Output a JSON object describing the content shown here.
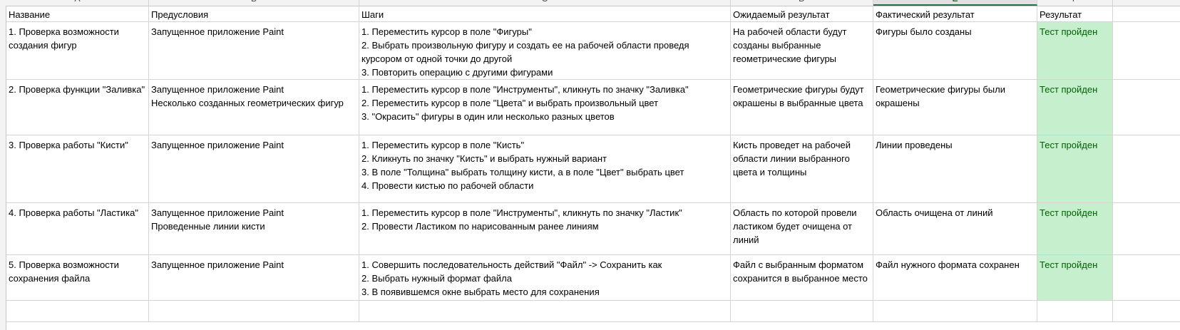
{
  "column_letters": [
    "A",
    "B",
    "C",
    "D",
    "E",
    "F"
  ],
  "selected_column": "E",
  "header": {
    "name": "Название",
    "preconditions": "Предусловия",
    "steps": "Шаги",
    "expected": "Ожидаемый результат",
    "actual": "Фактический результат",
    "result": "Результат"
  },
  "rows": [
    {
      "name": "1. Проверка возможности создания фигур",
      "preconditions": "Запущенное приложение Paint",
      "steps": "1. Переместить курсор в поле \"Фигуры\"\n2. Выбрать произвольную фигуру и создать ее на рабочей области проведя курсором от одной точки до другой\n3. Повторить операцию с другими фигурами",
      "expected": "На рабочей области будут созданы выбранные геометрические фигуры",
      "actual": "Фигуры было созданы",
      "result": "Тест пройден"
    },
    {
      "name": "2. Проверка функции \"Заливка\"",
      "preconditions": "Запущенное приложение Paint\nНесколько созданных геометрических фигур",
      "steps": "1. Переместить курсор в поле \"Инструменты\", кликнуть по значку \"Заливка\"\n2. Переместить курсор в поле \"Цвета\" и выбрать произвольный цвет\n3. \"Окрасить\" фигуры в один или несколько разных цветов",
      "expected": "Геометрические фигуры будут окрашены в выбранные цвета",
      "actual": "Геометрические фигуры были окрашены",
      "result": "Тест пройден"
    },
    {
      "name": "3. Проверка работы \"Кисти\"",
      "preconditions": "Запущенное приложение Paint",
      "steps": "1. Переместить курсор в поле \"Кисть\"\n2. Кликнуть по значку \"Кисть\" и выбрать нужный вариант\n3. В поле \"Толщина\" выбрать толщину кисти, а в поле \"Цвет\" выбрать цвет\n4. Провести кистью по рабочей области",
      "expected": "Кисть проведет на рабочей области линии выбранного цвета и толщины",
      "actual": "Линии проведены",
      "result": "Тест пройден"
    },
    {
      "name": "4. Проверка работы \"Ластика\"",
      "preconditions": "Запущенное приложение Paint\nПроведенные линии кисти",
      "steps": "1. Переместить курсор в поле \"Инструменты\", кликнуть по значку \"Ластик\"\n2. Провести Ластиком по нарисованным ранее линиям",
      "expected": "Область по которой провели ластиком будет очищена от линий",
      "actual": "Область очищена от линий",
      "result": "Тест пройден"
    },
    {
      "name": "5. Проверка возможности сохранения файла",
      "preconditions": "Запущенное приложение Paint",
      "steps": "1. Совершить последовательность действий \"Файл\" -> Сохранить как\n2. Выбрать нужный формат файла\n3. В появившемся окне выбрать место для сохранения",
      "expected": "Файл с выбранным форматом сохранится в выбранное место",
      "actual": "Файл нужного формата сохранен",
      "result": "Тест пройден"
    }
  ],
  "colors": {
    "pass_fill": "#c6efce",
    "pass_text": "#006100",
    "selected_header": "#217346"
  }
}
